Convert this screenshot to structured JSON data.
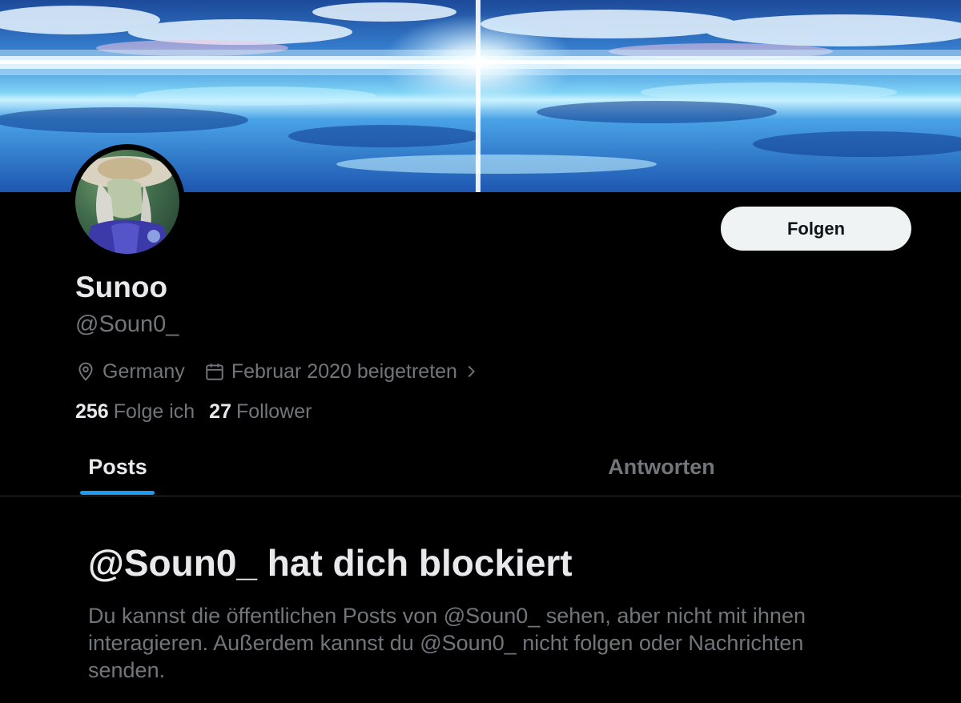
{
  "profile": {
    "display_name": "Sunoo",
    "handle": "@Soun0_",
    "location": "Germany",
    "joined": "Februar 2020 beigetreten",
    "following_count": "256",
    "following_label": "Folge ich",
    "followers_count": "27",
    "followers_label": "Follower"
  },
  "actions": {
    "follow_label": "Folgen"
  },
  "tabs": [
    {
      "label": "Posts",
      "active": true
    },
    {
      "label": "Antworten",
      "active": false
    }
  ],
  "blocked": {
    "title": "@Soun0_ hat dich blockiert",
    "message": "Du kannst die öffentlichen Posts von @Soun0_ sehen, aber nicht mit ihnen interagieren. Außerdem kannst du @Soun0_ nicht folgen oder Nachrichten senden."
  },
  "icons": {
    "location": "map-pin-icon",
    "joined": "calendar-icon",
    "more": "chevron-right-icon"
  },
  "colors": {
    "background": "#000000",
    "primary_text": "#e7e9ea",
    "secondary_text": "#71767b",
    "accent": "#1d9bf0",
    "button_bg": "#eff3f4"
  }
}
